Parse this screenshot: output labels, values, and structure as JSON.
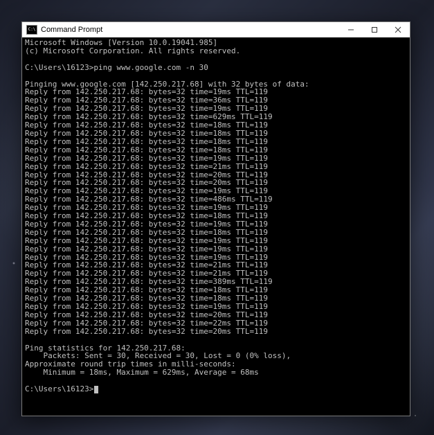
{
  "window": {
    "title": "Command Prompt",
    "icon_label": "C:\\"
  },
  "os": {
    "header": "Microsoft Windows [Version 10.0.19041.985]",
    "copyright": "(c) Microsoft Corporation. All rights reserved."
  },
  "session": {
    "prompt_path": "C:\\Users\\16123",
    "command": "ping www.google.com -n 30"
  },
  "ping": {
    "target_host": "www.google.com",
    "target_ip": "142.250.217.68",
    "bytes": 32,
    "ttl": 119,
    "header": "Pinging www.google.com [142.250.217.68] with 32 bytes of data:",
    "replies_ms": [
      19,
      36,
      19,
      629,
      18,
      18,
      18,
      18,
      19,
      21,
      20,
      20,
      19,
      486,
      19,
      18,
      19,
      18,
      19,
      19,
      19,
      21,
      21,
      389,
      18,
      18,
      19,
      20,
      22,
      20
    ],
    "stats_header": "Ping statistics for 142.250.217.68:",
    "packets_line": "    Packets: Sent = 30, Received = 30, Lost = 0 (0% loss),",
    "approx_line": "Approximate round trip times in milli-seconds:",
    "minmax_line": "    Minimum = 18ms, Maximum = 629ms, Average = 68ms"
  }
}
